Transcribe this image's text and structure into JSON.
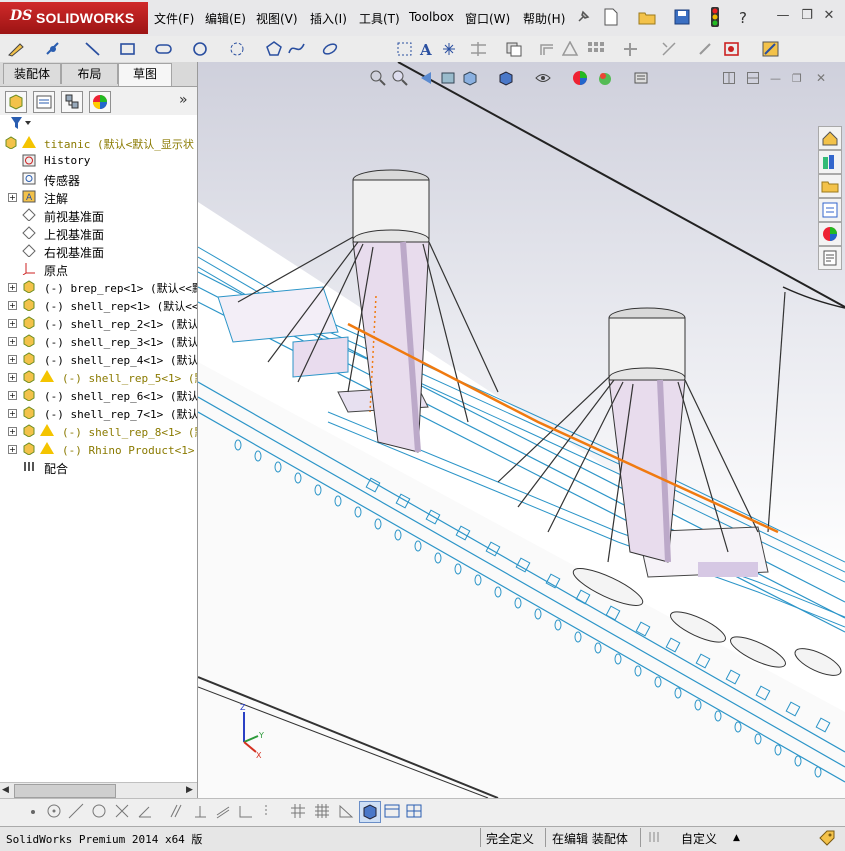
{
  "app": {
    "logo_ds": "DS",
    "logo_text": "SOLIDWORKS"
  },
  "menu": [
    "文件(F)",
    "编辑(E)",
    "视图(V)",
    "插入(I)",
    "工具(T)",
    "Toolbox",
    "窗口(W)",
    "帮助(H)"
  ],
  "tabs": [
    "装配体",
    "布局",
    "草图"
  ],
  "active_tab": "草图",
  "tree": [
    {
      "label": "titanic  (默认<默认_显示状",
      "warn": true,
      "kind": "root"
    },
    {
      "label": "History",
      "kind": "history"
    },
    {
      "label": "传感器",
      "kind": "sensor"
    },
    {
      "label": "注解",
      "kind": "annotation",
      "expand": true
    },
    {
      "label": "前视基准面",
      "kind": "plane"
    },
    {
      "label": "上视基准面",
      "kind": "plane"
    },
    {
      "label": "右视基准面",
      "kind": "plane"
    },
    {
      "label": "原点",
      "kind": "origin"
    },
    {
      "label": "(-) brep_rep<1> (默认<<默",
      "kind": "part",
      "expand": true
    },
    {
      "label": "(-) shell_rep<1> (默认<<默",
      "kind": "part",
      "expand": true
    },
    {
      "label": "(-) shell_rep_2<1> (默认<",
      "kind": "part",
      "expand": true
    },
    {
      "label": "(-) shell_rep_3<1> (默认<",
      "kind": "part",
      "expand": true
    },
    {
      "label": "(-) shell_rep_4<1> (默认<",
      "kind": "part",
      "expand": true
    },
    {
      "label": "(-) shell_rep_5<1> (默认",
      "kind": "part",
      "expand": true,
      "warn": true
    },
    {
      "label": "(-) shell_rep_6<1> (默认<",
      "kind": "part",
      "expand": true
    },
    {
      "label": "(-) shell_rep_7<1> (默认<",
      "kind": "part",
      "expand": true
    },
    {
      "label": "(-) shell_rep_8<1> (默认",
      "kind": "part",
      "expand": true,
      "warn": true
    },
    {
      "label": "(-) Rhino Product<1> (默",
      "kind": "part",
      "expand": true,
      "warn": true
    },
    {
      "label": "配合",
      "kind": "mates"
    }
  ],
  "status": {
    "product": "SolidWorks Premium 2014 x64 版",
    "defined": "完全定义",
    "editing": "在编辑 装配体",
    "custom": "自定义"
  },
  "triad": {
    "x": "X",
    "y": "Y",
    "z": "Z"
  },
  "colors": {
    "accent_red": "#c41e1e",
    "hull_blue": "#2c95c8",
    "rope_orange": "#f07a10",
    "warn_yellow": "#f4c400"
  }
}
